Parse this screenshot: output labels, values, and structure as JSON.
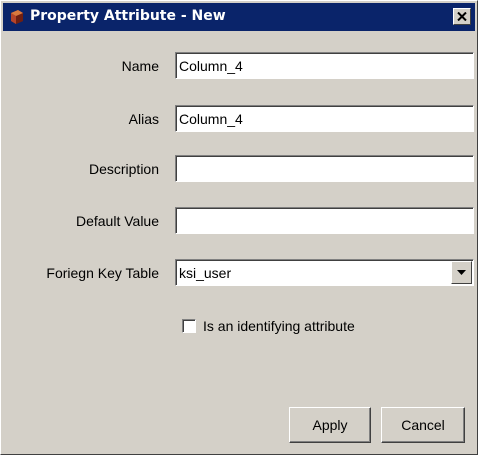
{
  "window": {
    "title": "Property Attribute - New",
    "icon": "app-icon"
  },
  "form": {
    "name": {
      "label": "Name",
      "value": "Column_4"
    },
    "alias": {
      "label": "Alias",
      "value": "Column_4"
    },
    "description": {
      "label": "Description",
      "value": ""
    },
    "default_value": {
      "label": "Default Value",
      "value": ""
    },
    "foreign_key_table": {
      "label": "Foriegn Key Table",
      "value": "ksi_user"
    },
    "identifying": {
      "label": "Is an identifying attribute",
      "checked": false
    }
  },
  "buttons": {
    "apply": "Apply",
    "cancel": "Cancel"
  },
  "colors": {
    "titlebar": "#0a246a",
    "face": "#d4d0c8"
  }
}
